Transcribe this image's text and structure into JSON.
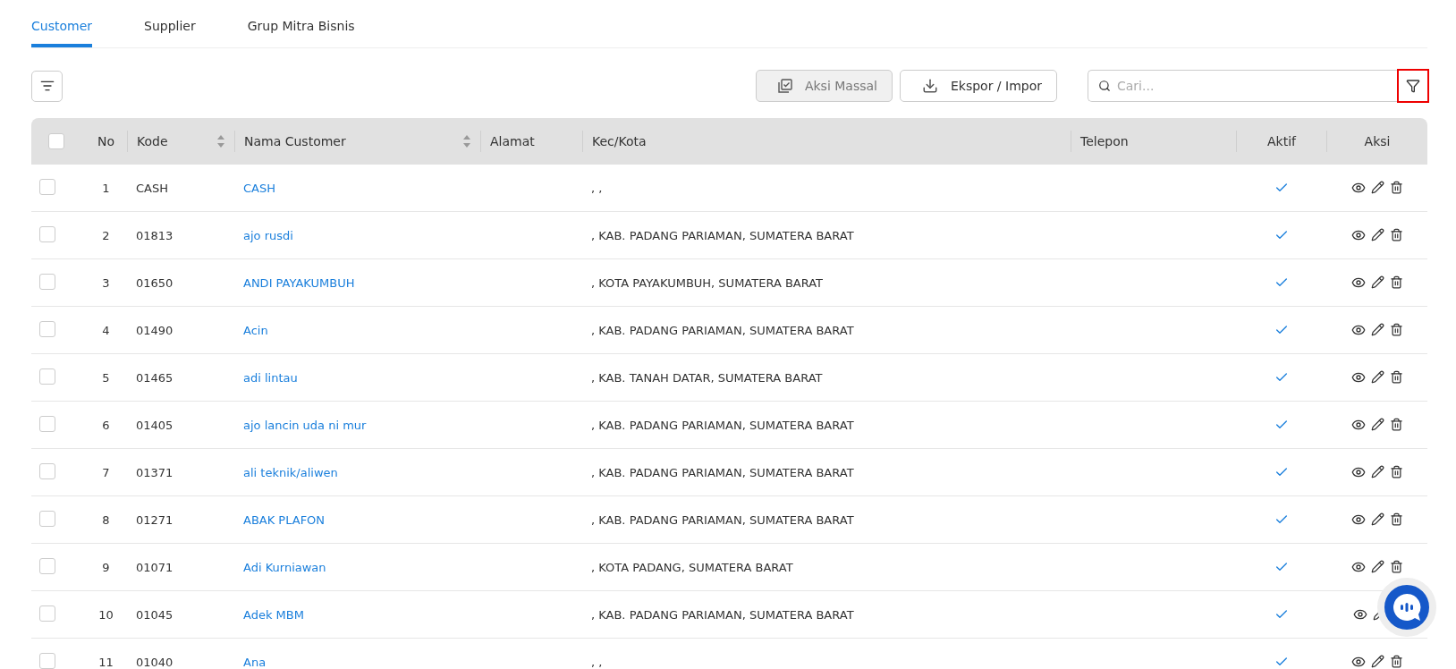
{
  "tabs": [
    {
      "label": "Customer",
      "selected": true
    },
    {
      "label": "Supplier",
      "selected": false
    },
    {
      "label": "Grup Mitra Bisnis",
      "selected": false
    }
  ],
  "toolbar": {
    "bulk_button": "Aksi Massal",
    "export_button": "Ekspor / Impor",
    "search": {
      "placeholder": "Cari..."
    }
  },
  "table": {
    "columns": [
      "No",
      "Kode",
      "Nama Customer",
      "Alamat",
      "Kec/Kota",
      "Telepon",
      "Aktif",
      "Aksi"
    ],
    "select_all_checked": false,
    "rows": [
      {
        "no": "1",
        "kode": "CASH",
        "nama": "CASH",
        "alamat": "",
        "kota": ", ,",
        "telepon": "",
        "aktif": true,
        "checked": false
      },
      {
        "no": "2",
        "kode": "01813",
        "nama": "ajo rusdi",
        "alamat": "",
        "kota": ", KAB. PADANG PARIAMAN, SUMATERA BARAT",
        "telepon": "",
        "aktif": true,
        "checked": false
      },
      {
        "no": "3",
        "kode": "01650",
        "nama": "ANDI PAYAKUMBUH",
        "alamat": "",
        "kota": ", KOTA PAYAKUMBUH, SUMATERA BARAT",
        "telepon": "",
        "aktif": true,
        "checked": false
      },
      {
        "no": "4",
        "kode": "01490",
        "nama": "Acin",
        "alamat": "",
        "kota": ", KAB. PADANG PARIAMAN, SUMATERA BARAT",
        "telepon": "",
        "aktif": true,
        "checked": false
      },
      {
        "no": "5",
        "kode": "01465",
        "nama": "adi lintau",
        "alamat": "",
        "kota": ", KAB. TANAH DATAR, SUMATERA BARAT",
        "telepon": "",
        "aktif": true,
        "checked": false
      },
      {
        "no": "6",
        "kode": "01405",
        "nama": "ajo lancin uda ni mur",
        "alamat": "",
        "kota": ", KAB. PADANG PARIAMAN, SUMATERA BARAT",
        "telepon": "",
        "aktif": true,
        "checked": false
      },
      {
        "no": "7",
        "kode": "01371",
        "nama": "ali teknik/aliwen",
        "alamat": "",
        "kota": ", KAB. PADANG PARIAMAN, SUMATERA BARAT",
        "telepon": "",
        "aktif": true,
        "checked": false
      },
      {
        "no": "8",
        "kode": "01271",
        "nama": "ABAK PLAFON",
        "alamat": "",
        "kota": ", KAB. PADANG PARIAMAN, SUMATERA BARAT",
        "telepon": "",
        "aktif": true,
        "checked": false
      },
      {
        "no": "9",
        "kode": "01071",
        "nama": "Adi Kurniawan",
        "alamat": "",
        "kota": ", KOTA PADANG, SUMATERA BARAT",
        "telepon": "",
        "aktif": true,
        "checked": false
      },
      {
        "no": "10",
        "kode": "01045",
        "nama": "Adek MBM",
        "alamat": "",
        "kota": ", KAB. PADANG PARIAMAN, SUMATERA BARAT",
        "telepon": "",
        "aktif": true,
        "checked": false
      },
      {
        "no": "11",
        "kode": "01040",
        "nama": "Ana",
        "alamat": "",
        "kota": ", ,",
        "telepon": "",
        "aktif": true,
        "checked": false
      }
    ]
  }
}
